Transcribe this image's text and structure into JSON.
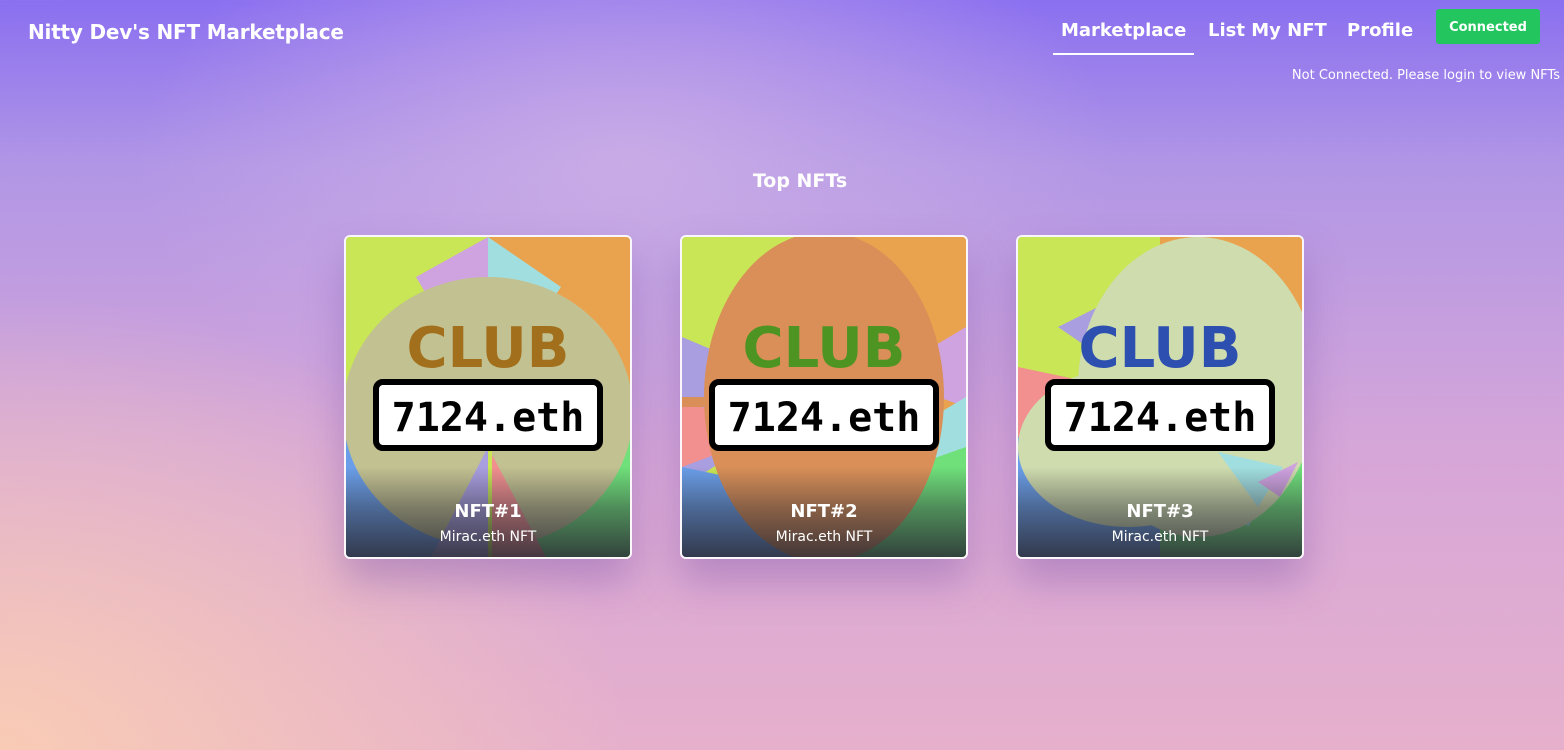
{
  "header": {
    "brand": "Nitty Dev's NFT Marketplace",
    "nav": [
      {
        "label": "Marketplace",
        "active": true
      },
      {
        "label": "List My NFT",
        "active": false
      },
      {
        "label": "Profile",
        "active": false
      }
    ],
    "connect_button": "Connected",
    "status_text": "Not Connected. Please login to view NFTs"
  },
  "main": {
    "section_title": "Top NFTs",
    "cards": [
      {
        "name": "NFT#1",
        "description": "Mirac.eth NFT",
        "image_title": "CLUB",
        "image_plate": "7124.eth",
        "title_color": "#a2701c"
      },
      {
        "name": "NFT#2",
        "description": "Mirac.eth NFT",
        "image_title": "CLUB",
        "image_plate": "7124.eth",
        "title_color": "#4e9422"
      },
      {
        "name": "NFT#3",
        "description": "Mirac.eth NFT",
        "image_title": "CLUB",
        "image_plate": "7124.eth",
        "title_color": "#2c4fb0"
      }
    ]
  },
  "colors": {
    "connect_button": "#22c55e",
    "background_top": "#8a6ff0",
    "background_bottom": "#f8cfb4"
  }
}
